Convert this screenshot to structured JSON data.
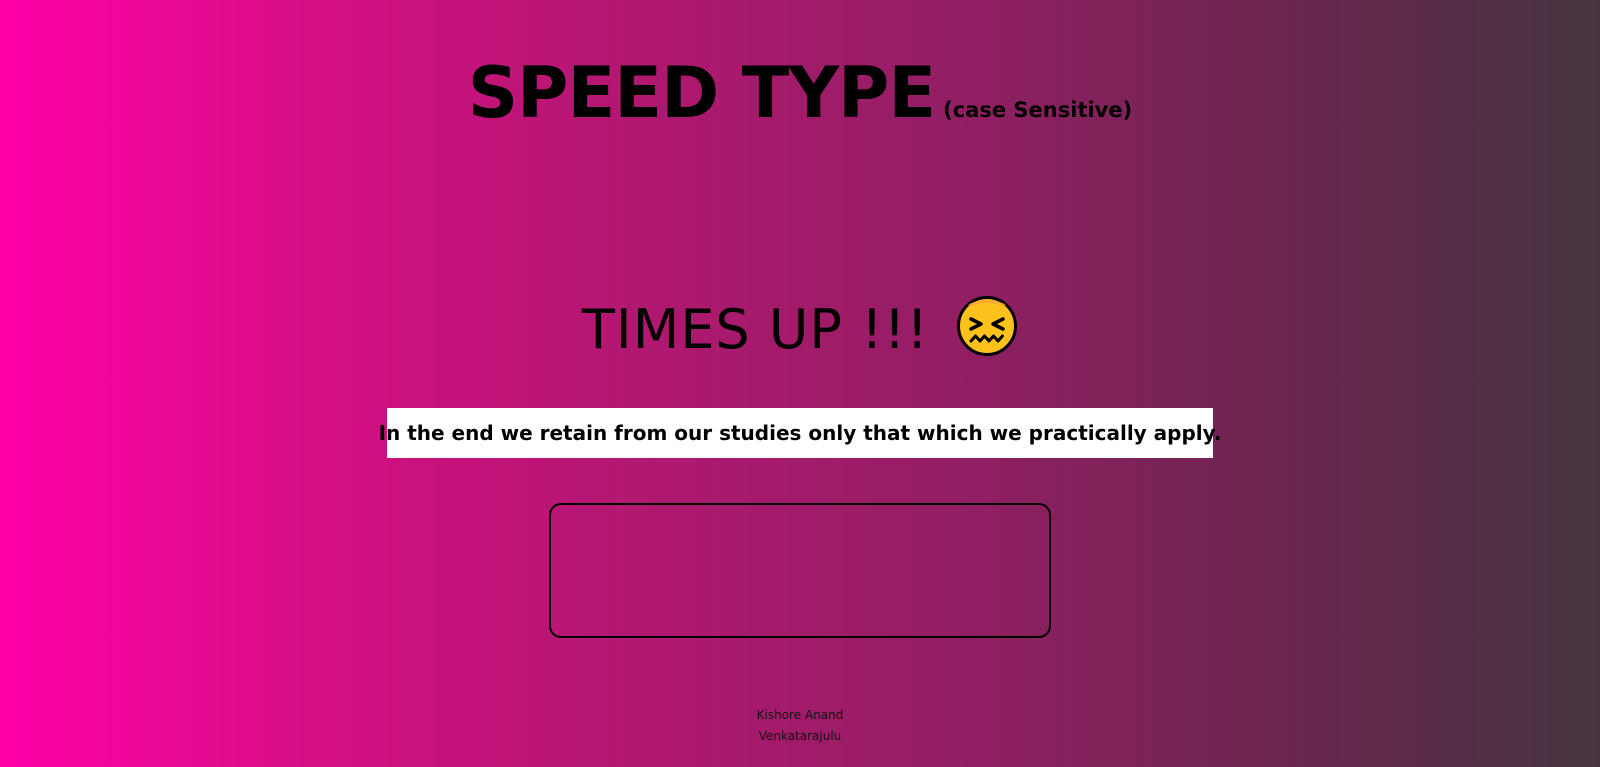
{
  "header": {
    "title": "SPEED TYPE",
    "subtitle": "(case Sensitive)"
  },
  "status": {
    "text": "TIMES UP !!!",
    "emoji_icon": "confounded-face-icon"
  },
  "quote": {
    "text": "In the end we retain from our studies only that which we practically apply."
  },
  "typing_input": {
    "value": "",
    "placeholder": ""
  },
  "footer": {
    "author_line1": "Kishore Anand",
    "author_line2": "Venkatarajulu"
  },
  "colors": {
    "gradient_start": "#ff00a8",
    "gradient_end": "#45343f",
    "quote_background": "#ffffff",
    "text": "#000000"
  }
}
